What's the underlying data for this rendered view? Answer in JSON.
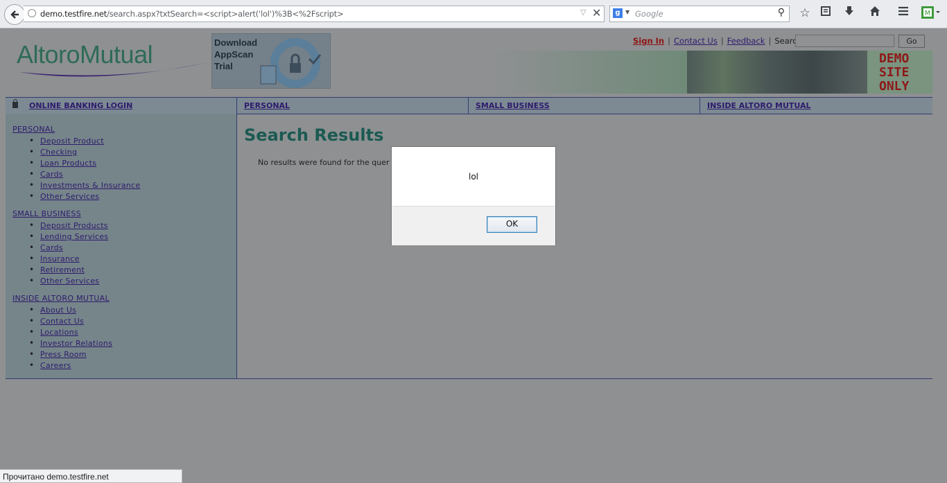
{
  "browser": {
    "url_host": "demo.testfire.net",
    "url_path": "/search.aspx?txtSearch=<script>alert('lol')%3B<%2Fscript>",
    "search_placeholder": "Google",
    "status_text": "Прочитано demo.testfire.net"
  },
  "header": {
    "logo_text": "AltoroMutual",
    "ad_lines": [
      "Download",
      "AppScan",
      "Trial"
    ],
    "links": {
      "sign_in": "Sign In",
      "contact_us": "Contact Us",
      "feedback": "Feedback",
      "search_label": "Search",
      "separator": "|"
    },
    "go_label": "Go",
    "demo_banner": [
      "DEMO",
      "SITE",
      "ONLY"
    ]
  },
  "nav": {
    "login": "ONLINE BANKING LOGIN",
    "personal": "PERSONAL",
    "small_business": "SMALL BUSINESS",
    "inside": "INSIDE ALTORO MUTUAL"
  },
  "sidebar": {
    "personal": {
      "title": "PERSONAL",
      "items": [
        "Deposit Product",
        "Checking",
        "Loan Products",
        "Cards",
        "Investments & Insurance",
        "Other Services"
      ]
    },
    "small_business": {
      "title": "SMALL BUSINESS",
      "items": [
        "Deposit Products",
        "Lending Services",
        "Cards",
        "Insurance",
        "Retirement",
        "Other Services"
      ]
    },
    "inside": {
      "title": "INSIDE ALTORO MUTUAL",
      "items": [
        "About Us",
        "Contact Us",
        "Locations",
        "Investor Relations",
        "Press Room",
        "Careers"
      ]
    }
  },
  "main": {
    "title": "Search Results",
    "no_results": "No results were found for the quer"
  },
  "dialog": {
    "message": "lol",
    "ok_label": "OK"
  }
}
